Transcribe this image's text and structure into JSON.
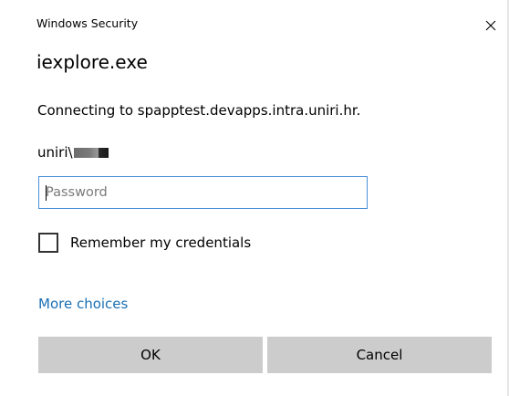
{
  "window": {
    "title": "Windows Security",
    "close_icon": "close-icon"
  },
  "dialog": {
    "app_name": "iexplore.exe",
    "connecting_message": "Connecting to spapptest.devapps.intra.uniri.hr.",
    "username": "uniri\\",
    "password": {
      "value": "",
      "placeholder": "Password"
    },
    "remember": {
      "label": "Remember my credentials",
      "checked": false
    },
    "more_choices": "More choices",
    "ok_label": "OK",
    "cancel_label": "Cancel"
  },
  "colors": {
    "link": "#1a6fb5",
    "input_border_focus": "#4a90d9",
    "button_bg": "#cccccc"
  }
}
